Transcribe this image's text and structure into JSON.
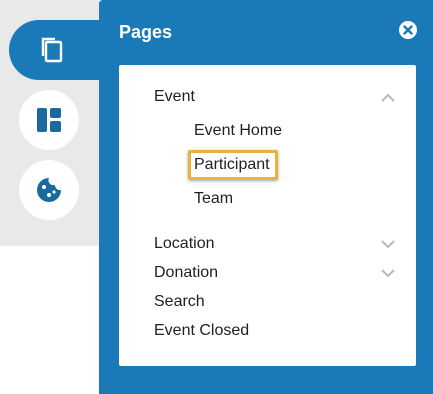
{
  "panel": {
    "title": "Pages"
  },
  "rail": {
    "items": [
      {
        "icon": "copy-icon",
        "active": true
      },
      {
        "icon": "layout-icon",
        "active": false
      },
      {
        "icon": "cookie-icon",
        "active": false
      }
    ]
  },
  "pages": {
    "event": {
      "label": "Event",
      "expanded": true,
      "children": [
        "Event Home",
        "Participant",
        "Team"
      ]
    },
    "location": {
      "label": "Location",
      "expanded": false
    },
    "donation": {
      "label": "Donation",
      "expanded": false
    },
    "search": {
      "label": "Search"
    },
    "event_closed": {
      "label": "Event Closed"
    }
  },
  "colors": {
    "panel_blue": "#1a7ab8",
    "highlight": "#e8b33a"
  }
}
